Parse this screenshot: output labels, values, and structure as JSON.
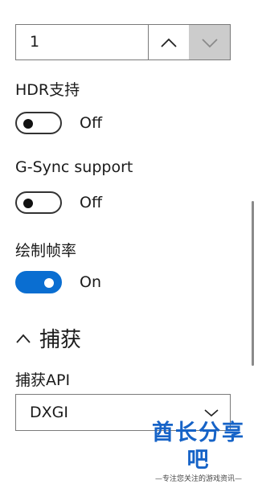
{
  "stepper": {
    "value": "1"
  },
  "settings": [
    {
      "label": "HDR支持",
      "state": "Off"
    },
    {
      "label": "G-Sync support",
      "state": "Off"
    },
    {
      "label": "绘制帧率",
      "state": "On"
    }
  ],
  "capture_section": {
    "title": "捕获",
    "api_label": "捕获API",
    "api_value": "DXGI"
  },
  "watermark": {
    "title": "酋长分享吧",
    "subtitle": "—专注您关注的游戏资讯—"
  },
  "colors": {
    "accent": "#0a6ed1",
    "watermark": "#1663c7"
  }
}
